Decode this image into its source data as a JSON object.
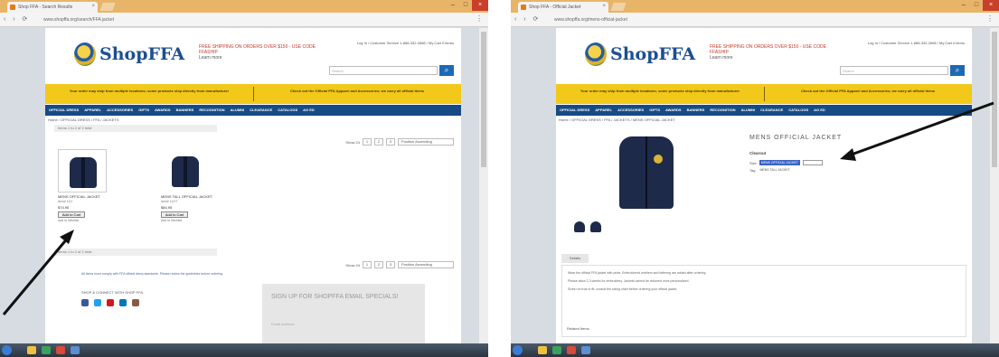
{
  "left_screenshot": {
    "browser": {
      "tab_title": "Shop FFA - Search Results",
      "url": "www.shopffa.org/search/FFA jacket",
      "nav_glyphs": "‹ › ⟳",
      "menu_glyph": "⋮",
      "window_buttons": [
        "–",
        "□",
        "×"
      ]
    },
    "site": {
      "brand": "ShopFFA",
      "promo": "FREE SHIPPING ON ORDERS OVER $150 - USE CODE FFASHIP",
      "promo_sub": "Learn more",
      "cart_text": "Log In / Customer Service 1-888-332-2668 / My Cart 0 items",
      "search_placeholder": "Search",
      "search_glyph": "⌕",
      "banner_left": "Your order may ship from multiple locations; some products ship directly from manufacturer",
      "banner_right": "Check out the Official FFA Apparel and Accessories; we carry all official items",
      "nav_items": [
        "OFFICIAL DRESS",
        "APPAREL",
        "ACCESSORIES",
        "GIFTS",
        "AWARDS",
        "BANNERS",
        "RECOGNITION",
        "ALUMNI",
        "CLEARANCE",
        "CATALOGS",
        "AG ED"
      ]
    },
    "breadcrumb": "Home / OFFICIAL DRESS / FFA / JACKETS",
    "toolbar_text": "Items 1 to 2 of 2 total",
    "pager": {
      "show_label": "Show 24",
      "pages": [
        "1",
        "2",
        "3"
      ],
      "sort": "Position Ascending"
    },
    "products": [
      {
        "name": "MENS OFFICIAL JACKET",
        "sub": "Item# 1OJ",
        "price": "$74.95",
        "button": "Add to Cart",
        "note": "Add to Wishlist"
      },
      {
        "name": "MENS TALL OFFICIAL JACKET",
        "sub": "Item# 1OJT",
        "price": "$84.95",
        "button": "Add to Cart",
        "note": "Add to Wishlist"
      }
    ],
    "bottom_toolbar": "Items 1 to 2 of 2 total",
    "bottom_pager": {
      "show_label": "Show 24",
      "pages": [
        "1",
        "2",
        "3"
      ],
      "sort": "Position Ascending"
    },
    "footnote": "All items must comply with FFA official dress standards. Please review the guidelines before ordering.",
    "social_label": "SHOP & CONNECT WITH SHOP FFA",
    "social_colors": [
      "#3b5998",
      "#1da1f2",
      "#cc181e",
      "#0077b5",
      "#8a5a44"
    ],
    "signup": {
      "title": "SIGN UP FOR SHOPFFA EMAIL SPECIALS!",
      "field": "Email address"
    },
    "colors": {
      "accent_blue": "#164b84",
      "banner_yellow": "#f2c81a",
      "arrow": "#111111"
    }
  },
  "right_screenshot": {
    "browser": {
      "tab_title": "Shop FFA - Official Jacket",
      "url": "www.shopffa.org/mens-official-jacket",
      "nav_glyphs": "‹ › ⟳",
      "menu_glyph": "⋮",
      "window_buttons": [
        "–",
        "□",
        "×"
      ]
    },
    "site": {
      "brand": "ShopFFA",
      "promo": "FREE SHIPPING ON ORDERS OVER $150 - USE CODE FFASHIP",
      "promo_sub": "Learn more",
      "cart_text": "Log In / Customer Service 1-888-332-2668 / My Cart 0 items",
      "search_placeholder": "Search",
      "search_glyph": "⌕",
      "banner_left": "Your order may ship from multiple locations; some products ship directly from manufacturer",
      "banner_right": "Check out the Official FFA Apparel and Accessories; we carry all official items",
      "nav_items": [
        "OFFICIAL DRESS",
        "APPAREL",
        "ACCESSORIES",
        "GIFTS",
        "AWARDS",
        "BANNERS",
        "RECOGNITION",
        "ALUMNI",
        "CLEARANCE",
        "CATALOGS",
        "AG ED"
      ]
    },
    "breadcrumb": "Home / OFFICIAL DRESS / FFA / JACKETS / MENS OFFICIAL JACKET",
    "product": {
      "title": "MENS OFFICIAL JACKET",
      "clearout": "Clearout",
      "options": [
        {
          "label": "Size",
          "value": "MENS OFFICIAL JACKET",
          "selected": true
        },
        {
          "label": "Tag",
          "value": "MENS TALL JACKET",
          "selected": false
        }
      ],
      "tab_label": "Details",
      "description": [
        "Wear the official FFA jacket with pride. Embroidered emblem and lettering are added after ordering.",
        "Please allow 2-3 weeks for embroidery. Jackets cannot be returned once personalized.",
        "Sizes run true to fit; consult the sizing chart before ordering your official jacket."
      ],
      "related_label": "Related Items"
    },
    "colors": {
      "accent_blue": "#164b84",
      "banner_yellow": "#f2c81a",
      "select_highlight": "#3b63c4",
      "arrow": "#111111"
    }
  }
}
